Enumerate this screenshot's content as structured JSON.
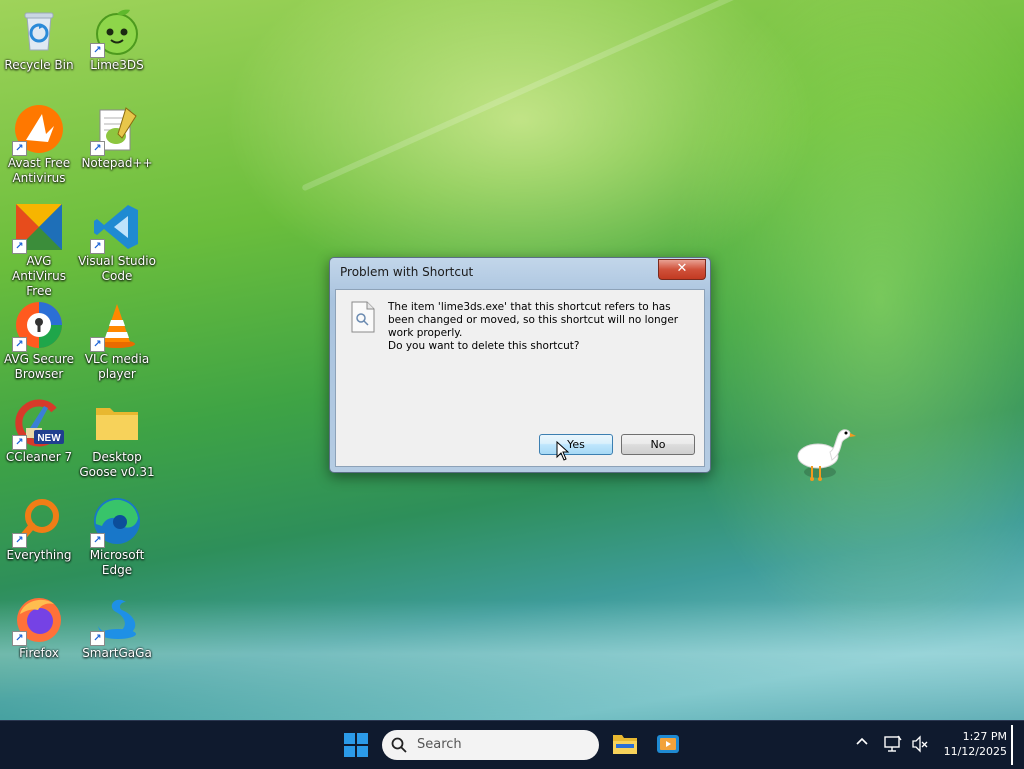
{
  "desktop": {
    "icons": [
      {
        "label": "Recycle Bin",
        "icon": "recycle-bin-icon"
      },
      {
        "label": "Lime3DS",
        "icon": "lime3ds-icon"
      },
      {
        "label": "Avast Free Antivirus",
        "icon": "avast-icon"
      },
      {
        "label": "Notepad++",
        "icon": "notepadpp-icon"
      },
      {
        "label": "AVG AntiVirus Free",
        "icon": "avg-antivirus-icon"
      },
      {
        "label": "Visual Studio Code",
        "icon": "vscode-icon"
      },
      {
        "label": "AVG Secure Browser",
        "icon": "avg-browser-icon"
      },
      {
        "label": "VLC media player",
        "icon": "vlc-icon"
      },
      {
        "label": "CCleaner 7",
        "icon": "ccleaner-icon",
        "badge": "NEW"
      },
      {
        "label": "Desktop Goose v0.31",
        "icon": "folder-icon"
      },
      {
        "label": "Everything",
        "icon": "everything-icon"
      },
      {
        "label": "Microsoft Edge",
        "icon": "edge-icon"
      },
      {
        "label": "Firefox",
        "icon": "firefox-icon"
      },
      {
        "label": "SmartGaGa",
        "icon": "smartgaga-icon"
      }
    ]
  },
  "dialog": {
    "title": "Problem with Shortcut",
    "close_label": "✕",
    "message": "The item 'lime3ds.exe' that this shortcut refers to has been changed or moved, so this shortcut will no longer work properly.",
    "question": "Do you want to delete this shortcut?",
    "yes_label": "Yes",
    "no_label": "No"
  },
  "taskbar": {
    "search_placeholder": "Search",
    "time": "1:27 PM",
    "date": "11/12/2025"
  },
  "colors": {
    "taskbar_bg": "#0f1a2e",
    "accent": "#0078d4"
  }
}
